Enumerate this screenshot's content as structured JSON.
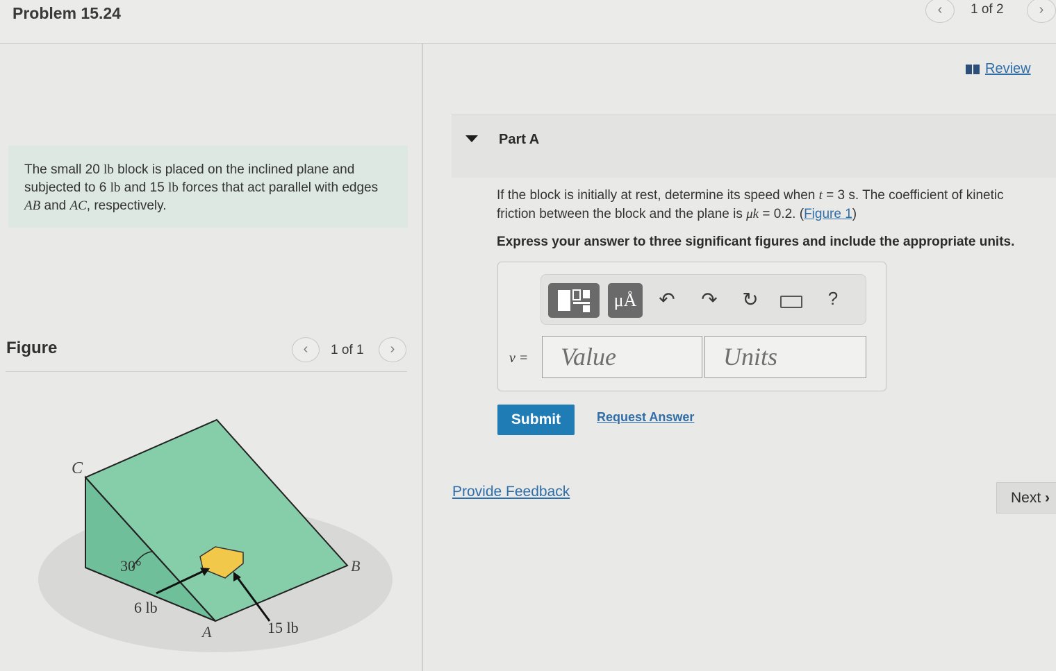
{
  "header": {
    "problem_title": "Problem 15.24",
    "page_indicator": "1 of 2"
  },
  "review_link": "Review",
  "problem_statement": {
    "t1": "The small 20 ",
    "u1": "lb",
    "t2": " block is placed on the inclined plane and subjected to 6 ",
    "u2": "lb",
    "t3": " and 15 ",
    "u3": "lb",
    "t4": " forces that act parallel with edges ",
    "e1": "AB",
    "t5": " and ",
    "e2": "AC",
    "t6": ", respectively."
  },
  "figure_panel": {
    "title": "Figure",
    "page_indicator": "1 of 1",
    "labels": {
      "c": "C",
      "b": "B",
      "a": "A",
      "angle": "30°",
      "force_small": "6 lb",
      "force_large": "15 lb"
    }
  },
  "part": {
    "label": "Part A",
    "q1": "If the block is initially at rest, determine its speed when ",
    "q_t": "t",
    "q2": " = 3 s. The coefficient of kinetic",
    "q3": "friction between the block and the plane is ",
    "q_mu": "μk",
    "q4": " = 0.2. (",
    "figure_link": "Figure 1",
    "q5": ")",
    "instruction": "Express your answer to three significant figures and include the appropriate units."
  },
  "answer": {
    "variable_label": "v =",
    "value_placeholder": "Value",
    "units_placeholder": "Units"
  },
  "toolbar": {
    "units_button": "μÅ",
    "help_button": "?"
  },
  "actions": {
    "submit": "Submit",
    "request_answer": "Request Answer",
    "provide_feedback": "Provide Feedback",
    "next": "Next"
  }
}
